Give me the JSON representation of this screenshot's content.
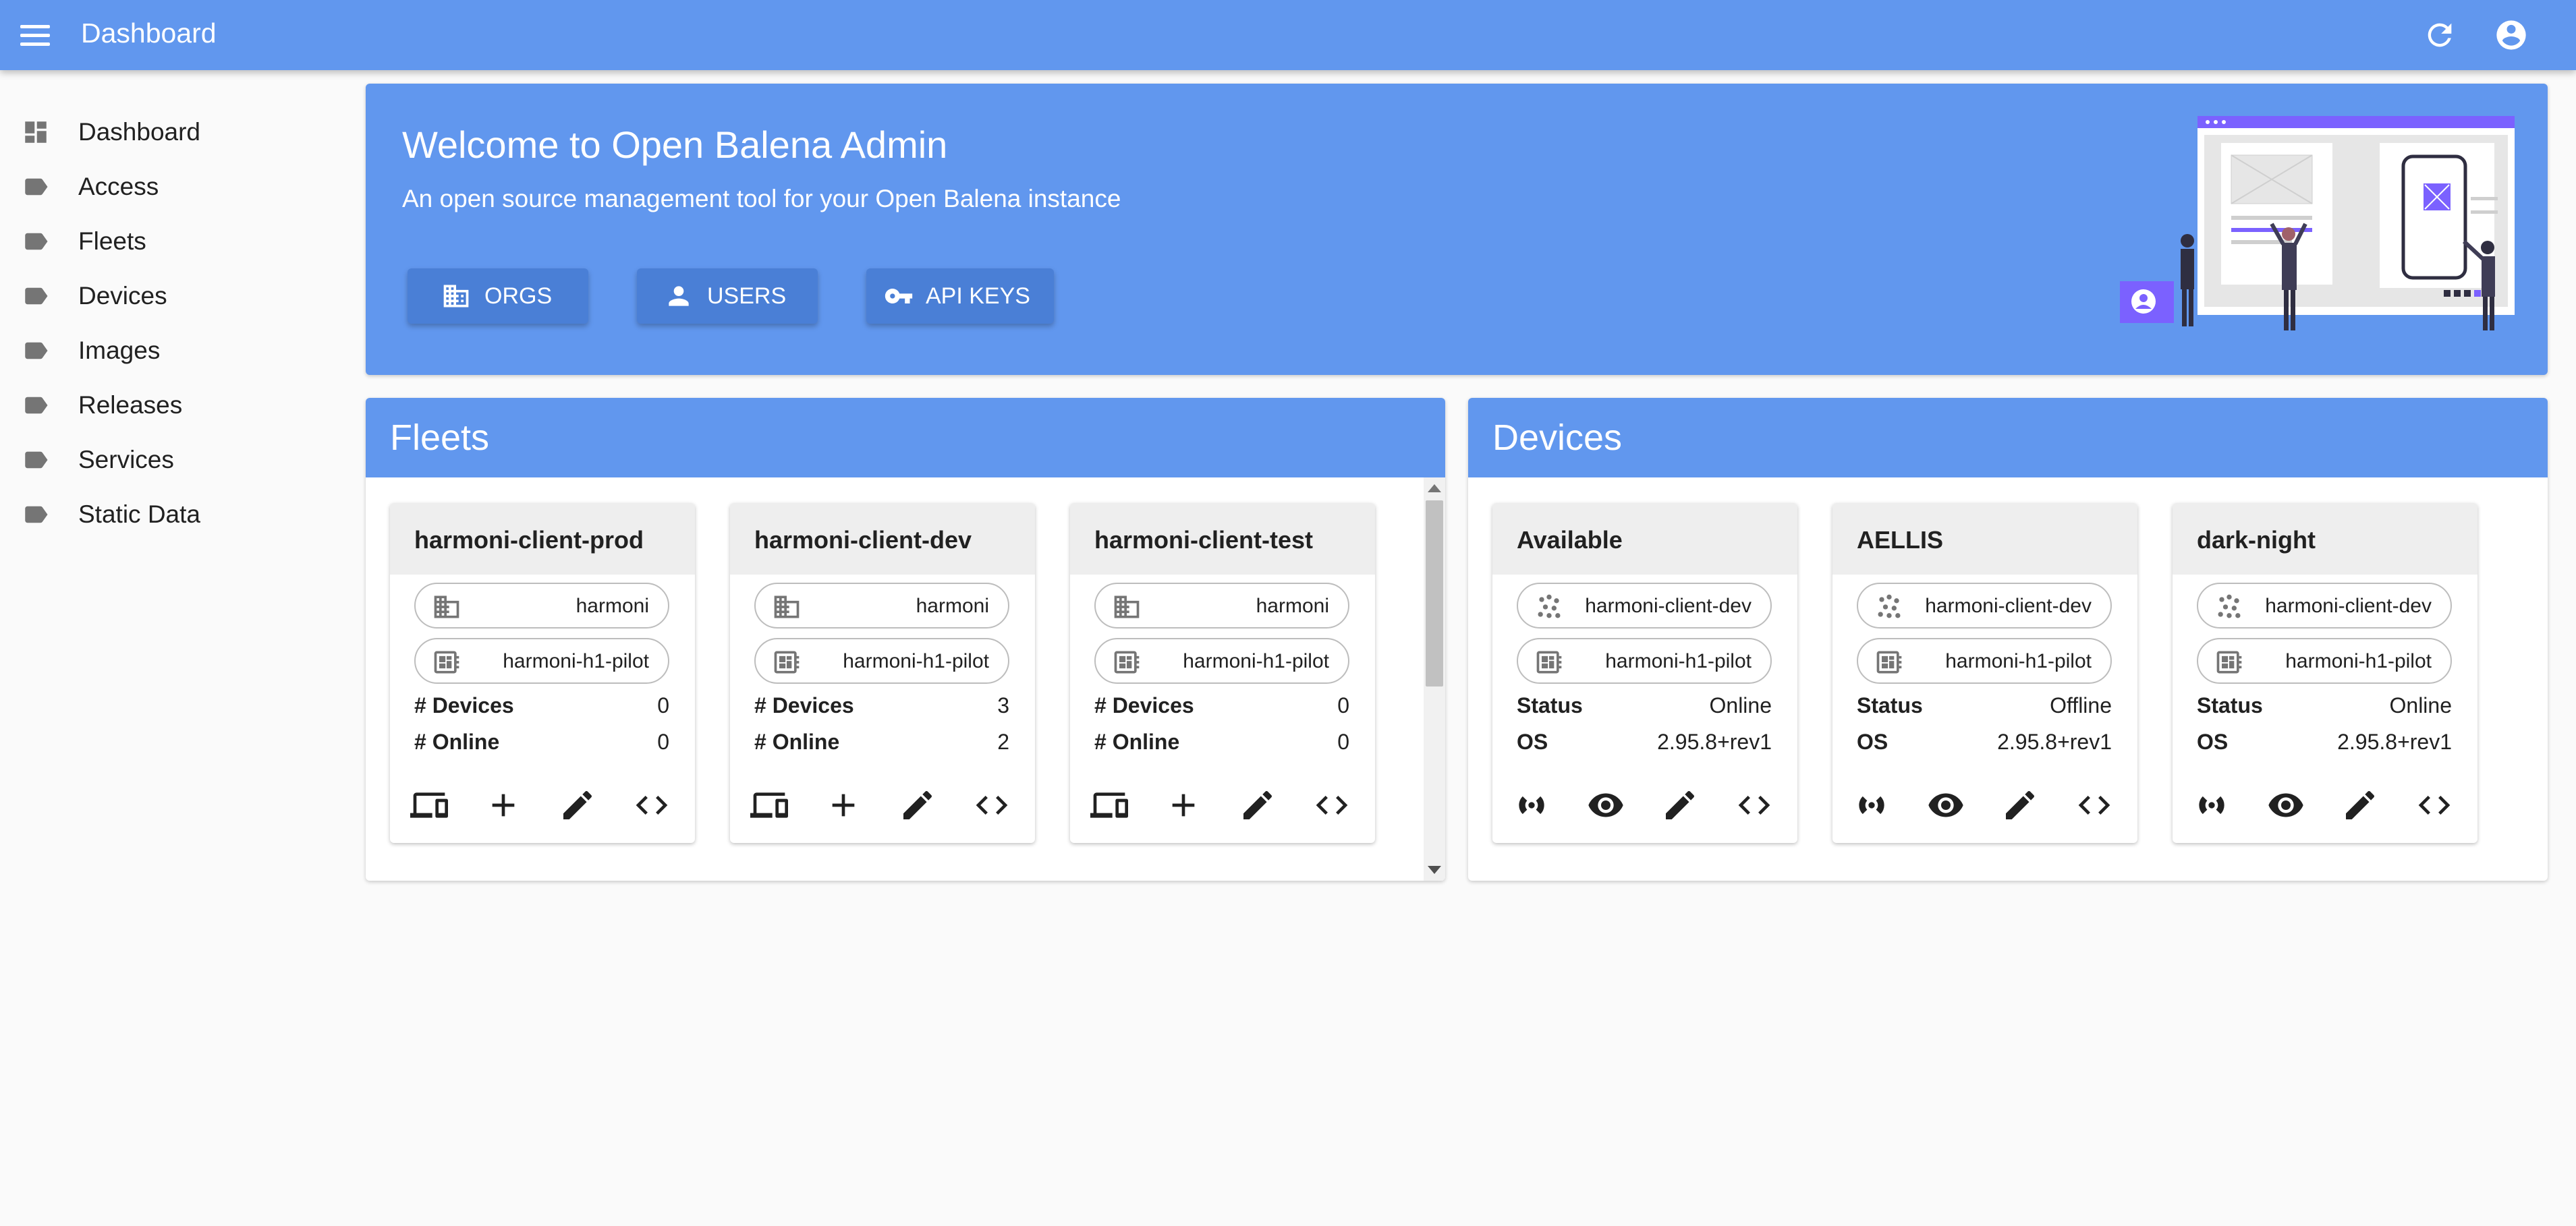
{
  "appbar": {
    "title": "Dashboard"
  },
  "sidebar": {
    "items": [
      {
        "label": "Dashboard",
        "icon": "dashboard-icon"
      },
      {
        "label": "Access",
        "icon": "label-icon"
      },
      {
        "label": "Fleets",
        "icon": "label-icon"
      },
      {
        "label": "Devices",
        "icon": "label-icon"
      },
      {
        "label": "Images",
        "icon": "label-icon"
      },
      {
        "label": "Releases",
        "icon": "label-icon"
      },
      {
        "label": "Services",
        "icon": "label-icon"
      },
      {
        "label": "Static Data",
        "icon": "label-icon"
      }
    ]
  },
  "welcome": {
    "title": "Welcome to Open Balena Admin",
    "subtitle": "An open source management tool for your Open Balena instance",
    "buttons": [
      {
        "label": "ORGS",
        "icon": "org-icon"
      },
      {
        "label": "USERS",
        "icon": "user-icon"
      },
      {
        "label": "API KEYS",
        "icon": "key-icon"
      }
    ]
  },
  "fleets": {
    "title": "Fleets",
    "cards": [
      {
        "name": "harmoni-client-prod",
        "org": "harmoni",
        "device_type": "harmoni-h1-pilot",
        "devices_label": "# Devices",
        "devices": "0",
        "online_label": "# Online",
        "online": "0"
      },
      {
        "name": "harmoni-client-dev",
        "org": "harmoni",
        "device_type": "harmoni-h1-pilot",
        "devices_label": "# Devices",
        "devices": "3",
        "online_label": "# Online",
        "online": "2"
      },
      {
        "name": "harmoni-client-test",
        "org": "harmoni",
        "device_type": "harmoni-h1-pilot",
        "devices_label": "# Devices",
        "devices": "0",
        "online_label": "# Online",
        "online": "0"
      }
    ]
  },
  "devices": {
    "title": "Devices",
    "cards": [
      {
        "name": "Available",
        "fleet": "harmoni-client-dev",
        "device_type": "harmoni-h1-pilot",
        "status_label": "Status",
        "status": "Online",
        "os_label": "OS",
        "os": "2.95.8+rev1"
      },
      {
        "name": "AELLIS",
        "fleet": "harmoni-client-dev",
        "device_type": "harmoni-h1-pilot",
        "status_label": "Status",
        "status": "Offline",
        "os_label": "OS",
        "os": "2.95.8+rev1"
      },
      {
        "name": "dark-night",
        "fleet": "harmoni-client-dev",
        "device_type": "harmoni-h1-pilot",
        "status_label": "Status",
        "status": "Online",
        "os_label": "OS",
        "os": "2.95.8+rev1"
      }
    ]
  },
  "colors": {
    "primary": "#6197ee",
    "button": "#4a7fd6",
    "illustration_accent": "#7b61ff"
  }
}
